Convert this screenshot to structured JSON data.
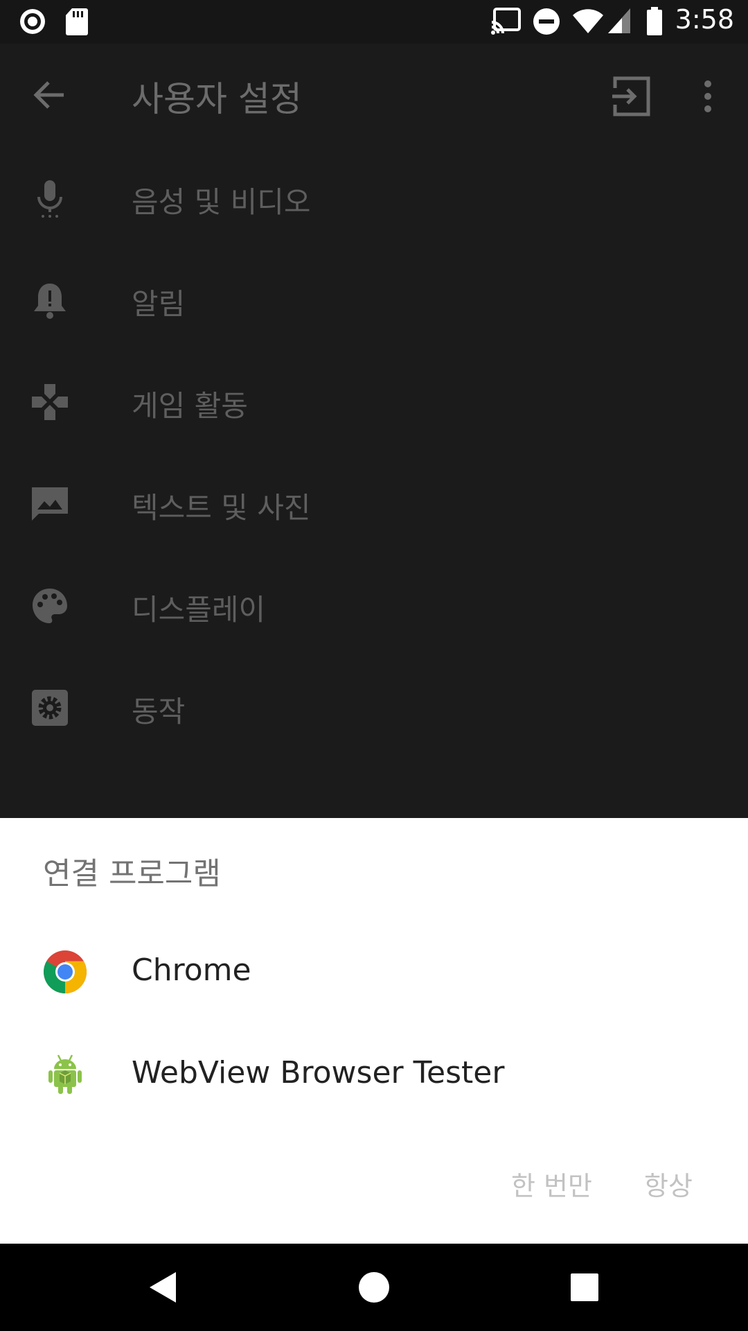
{
  "status_bar": {
    "time": "3:58",
    "icons": [
      "record-icon",
      "sd-card-icon",
      "cast-icon",
      "do-not-disturb-icon",
      "wifi-icon",
      "cell-signal-icon",
      "battery-icon"
    ]
  },
  "app_bar": {
    "title": "사용자 설정",
    "icons": [
      "back-arrow-icon",
      "exit-icon",
      "more-vert-icon"
    ]
  },
  "settings": {
    "items": [
      {
        "label": "음성 및 비디오",
        "icon": "mic-icon"
      },
      {
        "label": "알림",
        "icon": "bell-icon"
      },
      {
        "label": "게임 활동",
        "icon": "gamepad-icon"
      },
      {
        "label": "텍스트 및 사진",
        "icon": "image-icon"
      },
      {
        "label": "디스플레이",
        "icon": "palette-icon"
      },
      {
        "label": "동작",
        "icon": "gear-icon"
      }
    ]
  },
  "sheet": {
    "title": "연결 프로그램",
    "apps": [
      {
        "label": "Chrome",
        "icon": "chrome-icon"
      },
      {
        "label": "WebView Browser Tester",
        "icon": "android-icon"
      }
    ],
    "just_once_label": "한 번만",
    "always_label": "항상"
  },
  "nav_bar": {
    "icons": [
      "back-triangle-icon",
      "home-circle-icon",
      "recents-square-icon"
    ]
  },
  "colors": {
    "background_dim": "#1b1b1c",
    "status_bar": "#161617",
    "sheet": "#ffffff",
    "nav_bar": "#000000",
    "disabled_text": "#c2c2c2"
  }
}
